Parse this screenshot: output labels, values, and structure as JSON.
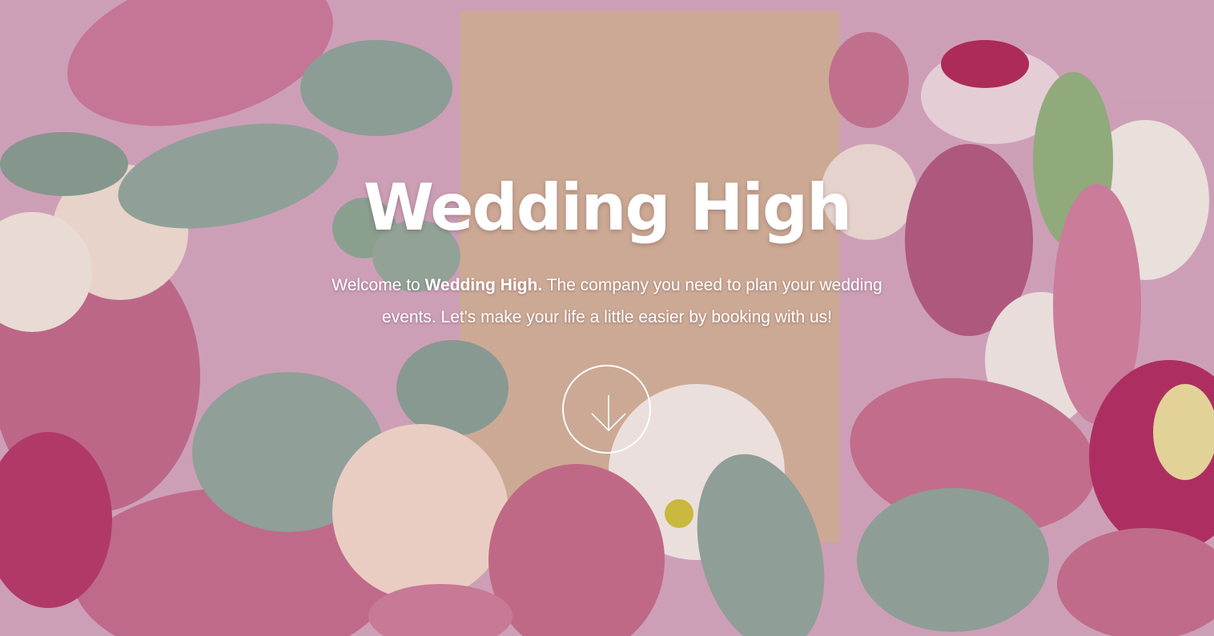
{
  "hero": {
    "title": "Wedding High",
    "subtitle_prefix": "Welcome to ",
    "subtitle_brand": "Wedding High.",
    "subtitle_rest": " The company you need to plan your wedding events. Let's make your life a little easier by booking with us!",
    "background": "flowers-photo",
    "scroll_icon": "arrow-down-icon"
  },
  "colors": {
    "text": "#ffffff",
    "background_pink": "#d9a8c0",
    "card_kraft": "#d4b39a",
    "orchid": "#c96a8d",
    "eucalyptus": "#8fa89c",
    "rose_cream": "#f5e6dc"
  }
}
